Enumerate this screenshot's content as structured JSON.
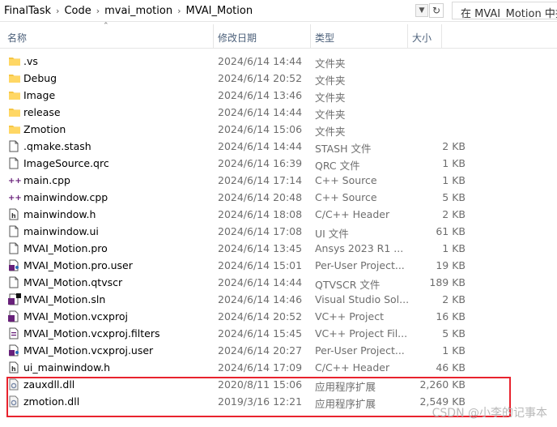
{
  "address": {
    "crumbs": [
      "FinalTask",
      "Code",
      "mvai_motion",
      "MVAI_Motion"
    ],
    "separator": "›",
    "search_placeholder": "在 MVAI_Motion 中搜"
  },
  "columns": {
    "name": "名称",
    "date": "修改日期",
    "type": "类型",
    "size": "大小"
  },
  "files": [
    {
      "name": ".vs",
      "date": "2024/6/14 14:44",
      "type": "文件夹",
      "size": "",
      "icon": "folder-icon"
    },
    {
      "name": "Debug",
      "date": "2024/6/14 20:52",
      "type": "文件夹",
      "size": "",
      "icon": "folder-icon"
    },
    {
      "name": "Image",
      "date": "2024/6/14 13:46",
      "type": "文件夹",
      "size": "",
      "icon": "folder-icon"
    },
    {
      "name": "release",
      "date": "2024/6/14 14:44",
      "type": "文件夹",
      "size": "",
      "icon": "folder-icon"
    },
    {
      "name": "Zmotion",
      "date": "2024/6/14 15:06",
      "type": "文件夹",
      "size": "",
      "icon": "folder-icon"
    },
    {
      "name": ".qmake.stash",
      "date": "2024/6/14 14:44",
      "type": "STASH 文件",
      "size": "2 KB",
      "icon": "file-icon"
    },
    {
      "name": "ImageSource.qrc",
      "date": "2024/6/14 16:39",
      "type": "QRC 文件",
      "size": "1 KB",
      "icon": "file-icon"
    },
    {
      "name": "main.cpp",
      "date": "2024/6/14 17:14",
      "type": "C++ Source",
      "size": "1 KB",
      "icon": "cpp-source-icon"
    },
    {
      "name": "mainwindow.cpp",
      "date": "2024/6/14 20:48",
      "type": "C++ Source",
      "size": "5 KB",
      "icon": "cpp-source-icon"
    },
    {
      "name": "mainwindow.h",
      "date": "2024/6/14 18:08",
      "type": "C/C++ Header",
      "size": "2 KB",
      "icon": "header-file-icon"
    },
    {
      "name": "mainwindow.ui",
      "date": "2024/6/14 17:08",
      "type": "UI 文件",
      "size": "61 KB",
      "icon": "file-icon"
    },
    {
      "name": "MVAI_Motion.pro",
      "date": "2024/6/14 13:45",
      "type": "Ansys 2023 R1 ...",
      "size": "1 KB",
      "icon": "file-icon"
    },
    {
      "name": "MVAI_Motion.pro.user",
      "date": "2024/6/14 15:01",
      "type": "Per-User Project...",
      "size": "19 KB",
      "icon": "user-project-icon"
    },
    {
      "name": "MVAI_Motion.qtvscr",
      "date": "2024/6/14 14:44",
      "type": "QTVSCR 文件",
      "size": "189 KB",
      "icon": "file-icon"
    },
    {
      "name": "MVAI_Motion.sln",
      "date": "2024/6/14 14:46",
      "type": "Visual Studio Sol...",
      "size": "2 KB",
      "icon": "vs-solution-icon"
    },
    {
      "name": "MVAI_Motion.vcxproj",
      "date": "2024/6/14 20:52",
      "type": "VC++ Project",
      "size": "16 KB",
      "icon": "vcxproj-icon"
    },
    {
      "name": "MVAI_Motion.vcxproj.filters",
      "date": "2024/6/14 15:45",
      "type": "VC++ Project Fil...",
      "size": "5 KB",
      "icon": "filters-icon"
    },
    {
      "name": "MVAI_Motion.vcxproj.user",
      "date": "2024/6/14 20:27",
      "type": "Per-User Project...",
      "size": "1 KB",
      "icon": "user-project-icon"
    },
    {
      "name": "ui_mainwindow.h",
      "date": "2024/6/14 17:09",
      "type": "C/C++ Header",
      "size": "46 KB",
      "icon": "header-file-icon"
    },
    {
      "name": "zauxdll.dll",
      "date": "2020/8/11 15:06",
      "type": "应用程序扩展",
      "size": "2,260 KB",
      "icon": "dll-icon"
    },
    {
      "name": "zmotion.dll",
      "date": "2019/3/16 12:21",
      "type": "应用程序扩展",
      "size": "2,549 KB",
      "icon": "dll-icon"
    }
  ],
  "watermark": "CSDN @小李的记事本",
  "colors": {
    "highlight": "#e8232e",
    "folder": "#f6c644",
    "header_text": "#4c607a"
  }
}
